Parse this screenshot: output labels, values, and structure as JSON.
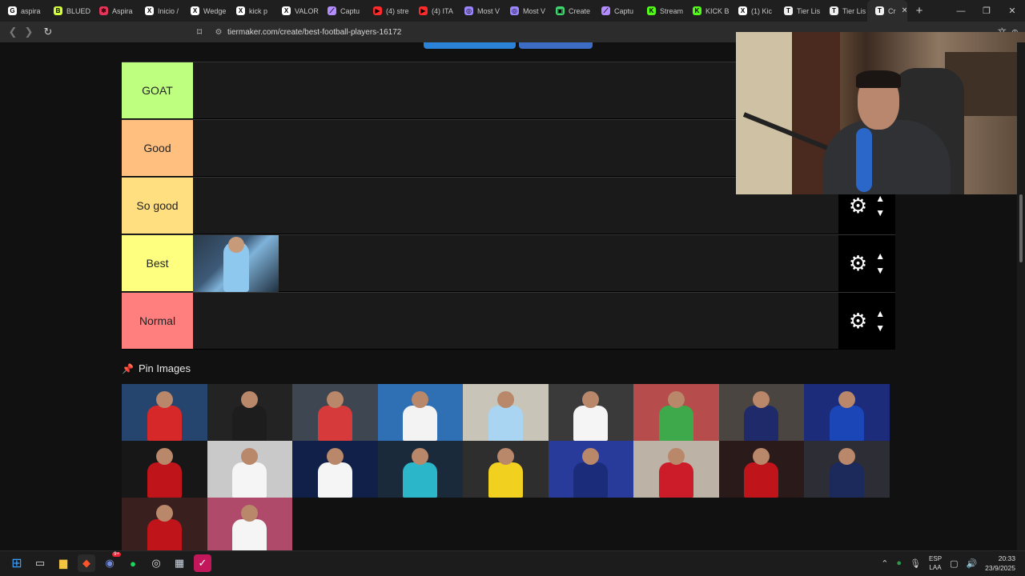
{
  "browser": {
    "tabs": [
      {
        "label": "aspira",
        "color": "#ffffff",
        "glyph": "G"
      },
      {
        "label": "BLUED",
        "color": "#d4ff3a",
        "glyph": "B"
      },
      {
        "label": "Aspira",
        "color": "#e8345a",
        "glyph": "✽"
      },
      {
        "label": "Inicio /",
        "color": "#ffffff",
        "glyph": "X"
      },
      {
        "label": "Wedge",
        "color": "#ffffff",
        "glyph": "X"
      },
      {
        "label": "kick p",
        "color": "#ffffff",
        "glyph": "X"
      },
      {
        "label": "VALOR",
        "color": "#ffffff",
        "glyph": "X"
      },
      {
        "label": "Captu",
        "color": "#b38cff",
        "glyph": "⟋"
      },
      {
        "label": "(4) stre",
        "color": "#ff2a2a",
        "glyph": "▶"
      },
      {
        "label": "(4) ITA",
        "color": "#ff2a2a",
        "glyph": "▶"
      },
      {
        "label": "Most V",
        "color": "#9b86ff",
        "glyph": "◎"
      },
      {
        "label": "Most V",
        "color": "#9b86ff",
        "glyph": "◎"
      },
      {
        "label": "Create",
        "color": "#3ed66e",
        "glyph": "▣"
      },
      {
        "label": "Captu",
        "color": "#b38cff",
        "glyph": "⟋"
      },
      {
        "label": "Stream",
        "color": "#53fc18",
        "glyph": "K"
      },
      {
        "label": "KICK B",
        "color": "#53fc18",
        "glyph": "K"
      },
      {
        "label": "(1) Kic",
        "color": "#ffffff",
        "glyph": "X"
      },
      {
        "label": "Tier Lis",
        "color": "#f0f0f0",
        "glyph": "T"
      },
      {
        "label": "Tier Lis",
        "color": "#f0f0f0",
        "glyph": "T"
      },
      {
        "label": "Cr",
        "color": "#f0f0f0",
        "glyph": "T"
      }
    ],
    "url": "tiermaker.com/create/best-football-players-16172"
  },
  "tiers": [
    {
      "label": "GOAT",
      "color": "#bfff7f"
    },
    {
      "label": "Good",
      "color": "#ffbf7f"
    },
    {
      "label": "So good",
      "color": "#ffdf7f"
    },
    {
      "label": "Best",
      "color": "#ffff7f"
    },
    {
      "label": "Normal",
      "color": "#ff7f7f"
    }
  ],
  "pin_images_label": "Pin Images",
  "pool_images": [
    {
      "kit": "#d62828",
      "bg": "#26456e"
    },
    {
      "kit": "#1d1d1d",
      "bg": "#232323"
    },
    {
      "kit": "#d63a3a",
      "bg": "#3d4651"
    },
    {
      "kit": "#f3f3f3",
      "bg": "#2f6fb3"
    },
    {
      "kit": "#a9d4f2",
      "bg": "#c9c4b8"
    },
    {
      "kit": "#f5f5f5",
      "bg": "#3a3a3a"
    },
    {
      "kit": "#3da94a",
      "bg": "#b64c4c"
    },
    {
      "kit": "#1f2a6b",
      "bg": "#4a4540"
    },
    {
      "kit": "#1a46b8",
      "bg": "#1c2c7a"
    },
    {
      "kit": "#c0141b",
      "bg": "#171717"
    },
    {
      "kit": "#f5f5f5",
      "bg": "#c9c9c9"
    },
    {
      "kit": "#f5f5f5",
      "bg": "#102048"
    },
    {
      "kit": "#2bb7c9",
      "bg": "#1b2a3a"
    },
    {
      "kit": "#f2d020",
      "bg": "#2e2e2e"
    },
    {
      "kit": "#1b2d7a",
      "bg": "#283a9a"
    },
    {
      "kit": "#cc1c2a",
      "bg": "#bdb2a6"
    },
    {
      "kit": "#c0141b",
      "bg": "#2a1a1a"
    },
    {
      "kit": "#1b2a5a",
      "bg": "#2d2d35"
    },
    {
      "kit": "#c0141b",
      "bg": "#3a1f1f"
    },
    {
      "kit": "#f5f5f5",
      "bg": "#b04a6a"
    }
  ],
  "taskbar": {
    "lang_top": "ESP",
    "lang_bottom": "LAA",
    "time": "20:33",
    "date": "23/9/2025",
    "badge": "9+"
  }
}
